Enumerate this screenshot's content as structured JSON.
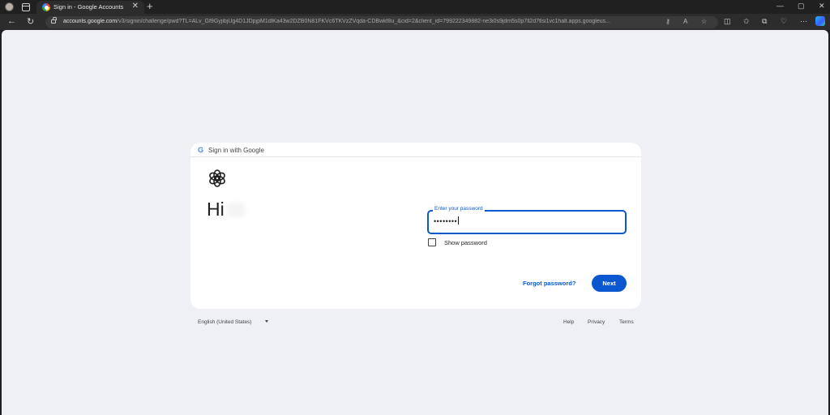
{
  "browser": {
    "tab_title": "Sign in - Google Accounts",
    "tab_close": "✕",
    "new_tab": "+",
    "url_host": "accounts.google.com",
    "url_rest": "/v3/signin/challenge/pwd?TL=ALv_Gf9GyjibjUg4D1JDpjpM1dlKa43w2DZB0N81FKVc6TKVzZVqda-CDBwkf8u_&cid=2&client_id=799222349882-ne3i0s9jdm5s0p7ll2d7tlsi1vc1halt.apps.googleus...",
    "window_controls": [
      "—",
      "▢",
      "✕"
    ]
  },
  "card": {
    "header_title": "Sign in with Google",
    "google_mark": "G",
    "greeting": "Hi",
    "password_label": "Enter your password",
    "password_value": "••••••••",
    "show_password_label": "Show password",
    "forgot_label": "Forgot password?",
    "next_label": "Next"
  },
  "footer": {
    "language": "English (United States)",
    "links": [
      "Help",
      "Privacy",
      "Terms"
    ]
  },
  "colors": {
    "accent": "#0b57d0",
    "page_bg": "#eef0f6"
  }
}
